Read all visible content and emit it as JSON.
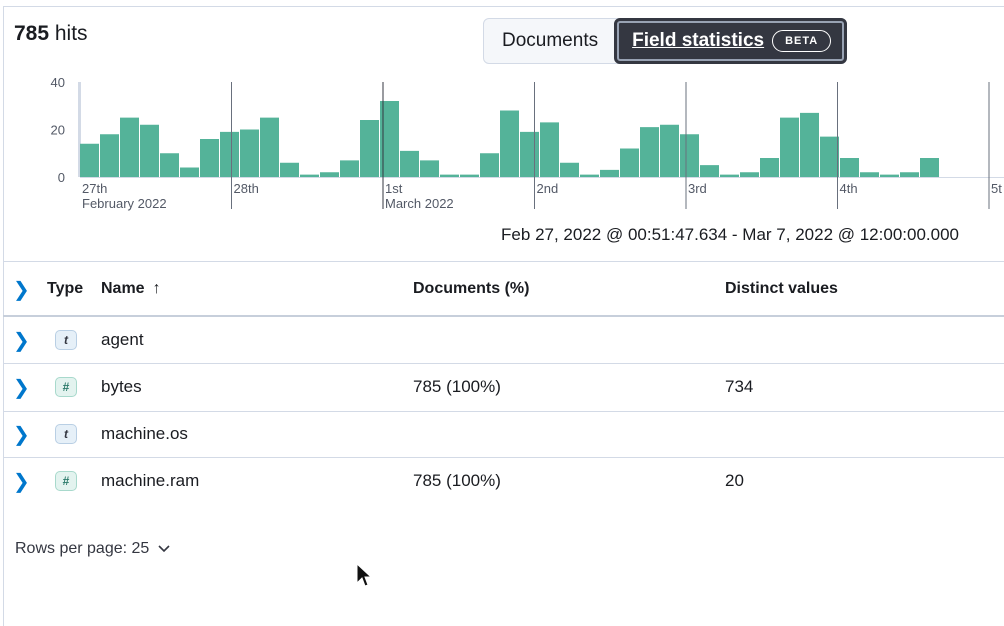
{
  "hits": {
    "count": "785",
    "suffix": " hits"
  },
  "view_toggle": {
    "documents": "Documents",
    "field_statistics": "Field statistics",
    "badge": "BETA"
  },
  "chart_data": {
    "type": "bar",
    "color": "#54b399",
    "ylim": [
      0,
      40
    ],
    "y_ticks": [
      "40",
      "20",
      "0"
    ],
    "day_labels": [
      {
        "day": "27th",
        "month": "February 2022"
      },
      {
        "day": "28th",
        "month": ""
      },
      {
        "day": "1st",
        "month": "March 2022"
      },
      {
        "day": "2nd",
        "month": ""
      },
      {
        "day": "3rd",
        "month": ""
      },
      {
        "day": "4th",
        "month": ""
      },
      {
        "day": "5t",
        "month": ""
      }
    ],
    "values": [
      14,
      18,
      25,
      22,
      10,
      4,
      16,
      19,
      20,
      25,
      6,
      1,
      2,
      7,
      24,
      32,
      11,
      7,
      1,
      1,
      10,
      28,
      19,
      23,
      6,
      1,
      3,
      12,
      21,
      22,
      18,
      5,
      1,
      2,
      8,
      25,
      27,
      17,
      8,
      2,
      1,
      2,
      8
    ]
  },
  "time_range": "Feb 27, 2022 @ 00:51:47.634 - Mar 7, 2022 @ 12:00:00.000",
  "table": {
    "headers": {
      "type": "Type",
      "name": "Name",
      "sort_arrow": "↑",
      "documents": "Documents (%)",
      "distinct": "Distinct values"
    },
    "rows": [
      {
        "type_glyph": "t",
        "type_kind": "text",
        "name": "agent",
        "documents": "",
        "distinct": ""
      },
      {
        "type_glyph": "#",
        "type_kind": "num",
        "name": "bytes",
        "documents": "785 (100%)",
        "distinct": "734"
      },
      {
        "type_glyph": "t",
        "type_kind": "text",
        "name": "machine.os",
        "documents": "",
        "distinct": ""
      },
      {
        "type_glyph": "#",
        "type_kind": "num",
        "name": "machine.ram",
        "documents": "785 (100%)",
        "distinct": "20"
      }
    ]
  },
  "pagination": {
    "rows_per_page": "Rows per page: 25"
  }
}
